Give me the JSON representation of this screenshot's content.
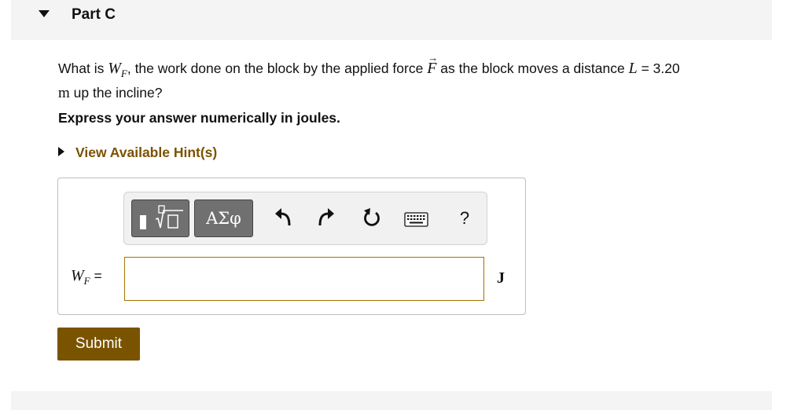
{
  "part": {
    "title": "Part C"
  },
  "question": {
    "prefix": "What is ",
    "symbol_W": "W",
    "symbol_sub": "F",
    "mid": ", the work done on the block by the applied force ",
    "symbol_force": "F",
    "suffix": " as the block moves a distance ",
    "symbol_L": "L",
    "value_text": " = 3.20",
    "unit_m": "m",
    "end": " up the incline?"
  },
  "instruction": "Express your answer numerically in joules.",
  "hints": {
    "label": "View Available Hint(s)"
  },
  "toolbar": {
    "greek_label": "ΑΣφ",
    "icons": [
      "templates-icon",
      "greek-symbols-icon",
      "undo-icon",
      "redo-icon",
      "reset-icon",
      "keyboard-icon",
      "help-icon"
    ],
    "help_label": "?"
  },
  "answer": {
    "label_symbol": "W",
    "label_sub": "F",
    "label_equals": " =",
    "value": "",
    "placeholder": "",
    "unit": "J"
  },
  "submit": {
    "label": "Submit"
  },
  "colors": {
    "accent": "#7a5300",
    "header_bg": "#f4f4f4",
    "toolbar_button": "#707070"
  }
}
